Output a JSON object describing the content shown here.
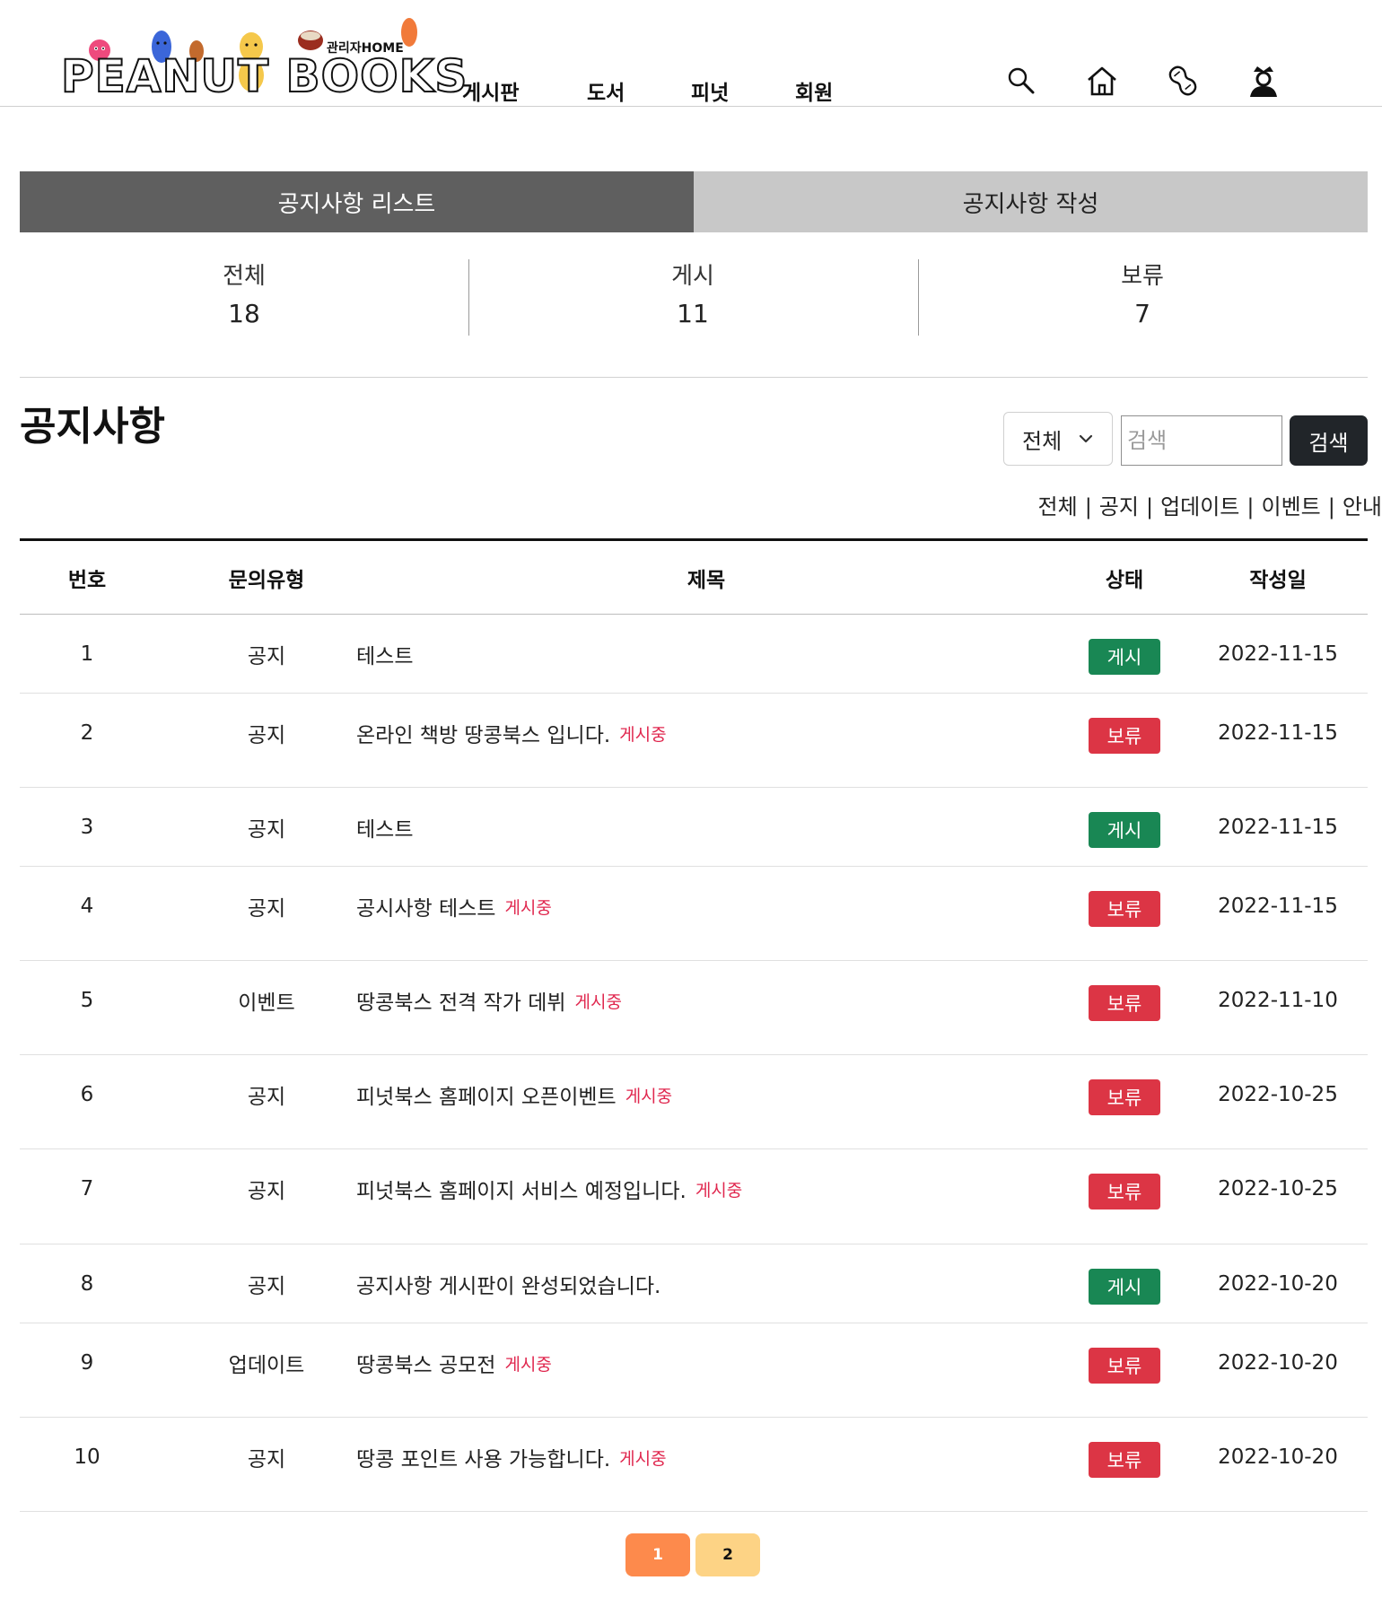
{
  "header": {
    "logo_text": "PEANUT BOOKS",
    "logo_admin": "관리자HOME",
    "nav": [
      "게시판",
      "도서",
      "피넛",
      "회원"
    ]
  },
  "tabs": {
    "list": "공지사항 리스트",
    "write": "공지사항 작성"
  },
  "stats": [
    {
      "label": "전체",
      "value": "18"
    },
    {
      "label": "게시",
      "value": "11"
    },
    {
      "label": "보류",
      "value": "7"
    }
  ],
  "section": {
    "title": "공지사항",
    "select_value": "전체",
    "search_placeholder": "검색",
    "search_button": "검색",
    "filters": [
      "전체",
      "공지",
      "업데이트",
      "이벤트",
      "안내"
    ]
  },
  "table": {
    "headers": [
      "번호",
      "문의유형",
      "제목",
      "상태",
      "작성일"
    ],
    "rows": [
      {
        "num": "1",
        "type": "공지",
        "title": "테스트",
        "live": "",
        "status": "게시",
        "status_kind": "post",
        "date": "2022-11-15"
      },
      {
        "num": "2",
        "type": "공지",
        "title": "온라인 책방 땅콩북스 입니다.",
        "live": "게시중",
        "status": "보류",
        "status_kind": "hold",
        "date": "2022-11-15"
      },
      {
        "num": "3",
        "type": "공지",
        "title": "테스트",
        "live": "",
        "status": "게시",
        "status_kind": "post",
        "date": "2022-11-15"
      },
      {
        "num": "4",
        "type": "공지",
        "title": "공시사항 테스트",
        "live": "게시중",
        "status": "보류",
        "status_kind": "hold",
        "date": "2022-11-15"
      },
      {
        "num": "5",
        "type": "이벤트",
        "title": "땅콩북스 전격 작가 데뷔",
        "live": "게시중",
        "status": "보류",
        "status_kind": "hold",
        "date": "2022-11-10"
      },
      {
        "num": "6",
        "type": "공지",
        "title": "피넛북스 홈페이지 오픈이벤트",
        "live": "게시중",
        "status": "보류",
        "status_kind": "hold",
        "date": "2022-10-25"
      },
      {
        "num": "7",
        "type": "공지",
        "title": "피넛북스 홈페이지 서비스 예정입니다.",
        "live": "게시중",
        "status": "보류",
        "status_kind": "hold",
        "date": "2022-10-25"
      },
      {
        "num": "8",
        "type": "공지",
        "title": "공지사항 게시판이 완성되었습니다.",
        "live": "",
        "status": "게시",
        "status_kind": "post",
        "date": "2022-10-20"
      },
      {
        "num": "9",
        "type": "업데이트",
        "title": "땅콩북스 공모전",
        "live": "게시중",
        "status": "보류",
        "status_kind": "hold",
        "date": "2022-10-20"
      },
      {
        "num": "10",
        "type": "공지",
        "title": "땅콩 포인트 사용 가능합니다.",
        "live": "게시중",
        "status": "보류",
        "status_kind": "hold",
        "date": "2022-10-20"
      }
    ]
  },
  "pagination": [
    "1",
    "2"
  ],
  "icons": {
    "header": [
      "search-icon",
      "home-icon",
      "peanut-icon",
      "crown-user-icon"
    ],
    "select": "chevron-down-icon"
  },
  "colors": {
    "tab_active": "#5f5f5f",
    "tab_inactive": "#c8c8c8",
    "badge_post": "#198754",
    "badge_hold": "#dc3545",
    "live_text": "#e0284f",
    "page_active": "#fd8a4c",
    "page_inactive": "#fdd385",
    "search_button": "#212529"
  }
}
